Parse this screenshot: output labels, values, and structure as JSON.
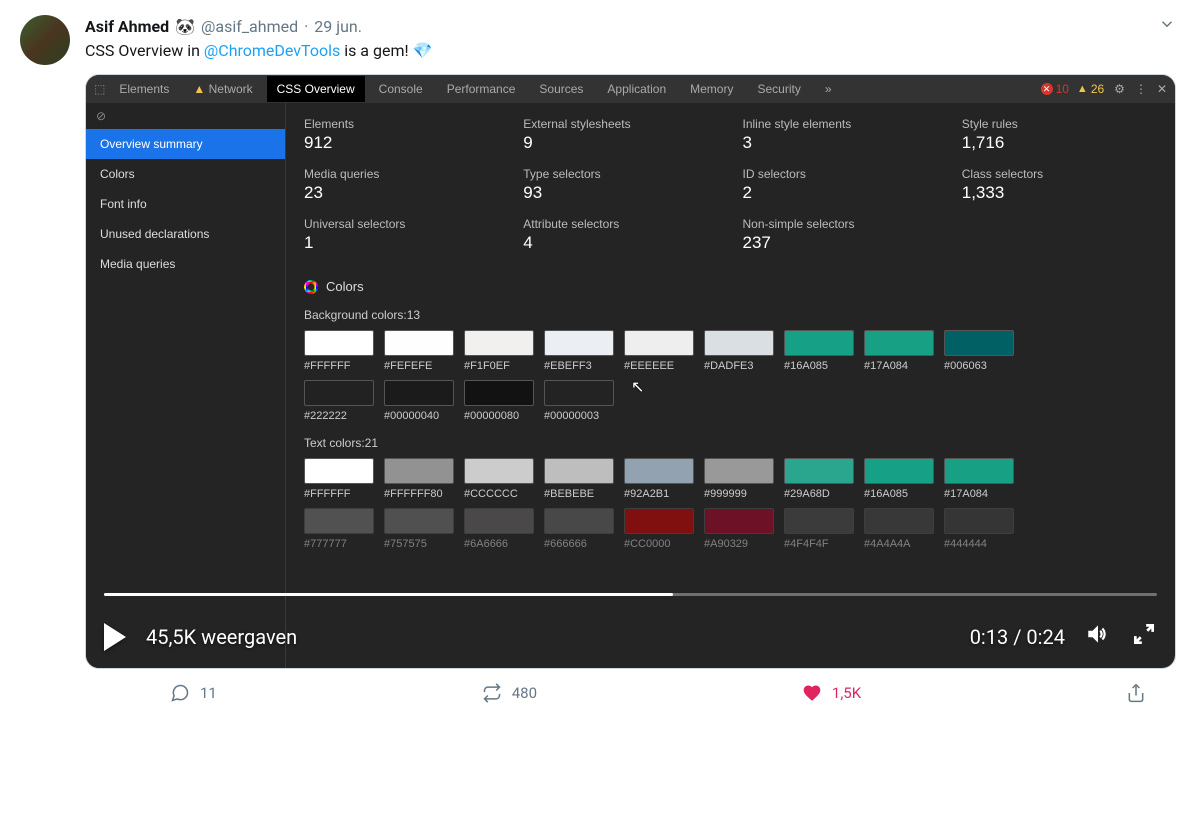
{
  "tweet": {
    "author_name": "Asif Ahmed",
    "panda": "🐼",
    "handle": "@asif_ahmed",
    "dot": "·",
    "date": "29 jun.",
    "text_before": "CSS Overview in ",
    "mention": "@ChromeDevTools",
    "text_after": " is a gem! ",
    "gem": "💎"
  },
  "devtools": {
    "tabs": [
      "Elements",
      "Network",
      "CSS Overview",
      "Console",
      "Performance",
      "Sources",
      "Application",
      "Memory",
      "Security"
    ],
    "active_tab": "CSS Overview",
    "more": "»",
    "err_count": "10",
    "warn_count": "26",
    "sidebar": [
      "Overview summary",
      "Colors",
      "Font info",
      "Unused declarations",
      "Media queries"
    ],
    "sidebar_active": "Overview summary",
    "stats": [
      {
        "label": "Elements",
        "value": "912"
      },
      {
        "label": "External stylesheets",
        "value": "9"
      },
      {
        "label": "Inline style elements",
        "value": "3"
      },
      {
        "label": "Style rules",
        "value": "1,716"
      },
      {
        "label": "Media queries",
        "value": "23"
      },
      {
        "label": "Type selectors",
        "value": "93"
      },
      {
        "label": "ID selectors",
        "value": "2"
      },
      {
        "label": "Class selectors",
        "value": "1,333"
      },
      {
        "label": "Universal selectors",
        "value": "1"
      },
      {
        "label": "Attribute selectors",
        "value": "4"
      },
      {
        "label": "Non-simple selectors",
        "value": "237"
      }
    ],
    "colors_title": "Colors",
    "bg_label": "Background colors:13",
    "bg_colors_row1": [
      {
        "hex": "#FFFFFF",
        "c": "#FFFFFF"
      },
      {
        "hex": "#FEFEFE",
        "c": "#FEFEFE"
      },
      {
        "hex": "#F1F0EF",
        "c": "#F1F0EF"
      },
      {
        "hex": "#EBEFF3",
        "c": "#EBEFF3"
      },
      {
        "hex": "#EEEEEE",
        "c": "#EEEEEE"
      },
      {
        "hex": "#DADFE3",
        "c": "#DADFE3"
      },
      {
        "hex": "#16A085",
        "c": "#16A085"
      },
      {
        "hex": "#17A084",
        "c": "#17A084"
      },
      {
        "hex": "#006063",
        "c": "#006063"
      }
    ],
    "bg_colors_row2": [
      {
        "hex": "#222222",
        "c": "#222222"
      },
      {
        "hex": "#00000040",
        "c": "rgba(0,0,0,0.25)"
      },
      {
        "hex": "#00000080",
        "c": "rgba(0,0,0,0.5)"
      },
      {
        "hex": "#00000003",
        "c": "rgba(0,0,0,0.01)"
      }
    ],
    "txt_label": "Text colors:21",
    "txt_colors_row1": [
      {
        "hex": "#FFFFFF",
        "c": "#FFFFFF"
      },
      {
        "hex": "#FFFFFF80",
        "c": "rgba(255,255,255,0.5)"
      },
      {
        "hex": "#CCCCCC",
        "c": "#CCCCCC"
      },
      {
        "hex": "#BEBEBE",
        "c": "#BEBEBE"
      },
      {
        "hex": "#92A2B1",
        "c": "#92A2B1"
      },
      {
        "hex": "#999999",
        "c": "#999999"
      },
      {
        "hex": "#29A68D",
        "c": "#29A68D"
      },
      {
        "hex": "#16A085",
        "c": "#16A085"
      },
      {
        "hex": "#17A084",
        "c": "#17A084"
      }
    ],
    "txt_colors_row2": [
      {
        "hex": "#777777",
        "c": "#777777"
      },
      {
        "hex": "#757575",
        "c": "#757575"
      },
      {
        "hex": "#6A6666",
        "c": "#6A6666"
      },
      {
        "hex": "#666666",
        "c": "#666666"
      },
      {
        "hex": "#CC0000",
        "c": "#CC0000"
      },
      {
        "hex": "#A90329",
        "c": "#A90329"
      },
      {
        "hex": "#4F4F4F",
        "c": "#4F4F4F"
      },
      {
        "hex": "#4A4A4A",
        "c": "#4A4A4A"
      },
      {
        "hex": "#444444",
        "c": "#444444"
      }
    ]
  },
  "video": {
    "views": "45,5K weergaven",
    "time": "0:13 / 0:24"
  },
  "actions": {
    "replies": "11",
    "retweets": "480",
    "likes": "1,5K"
  }
}
